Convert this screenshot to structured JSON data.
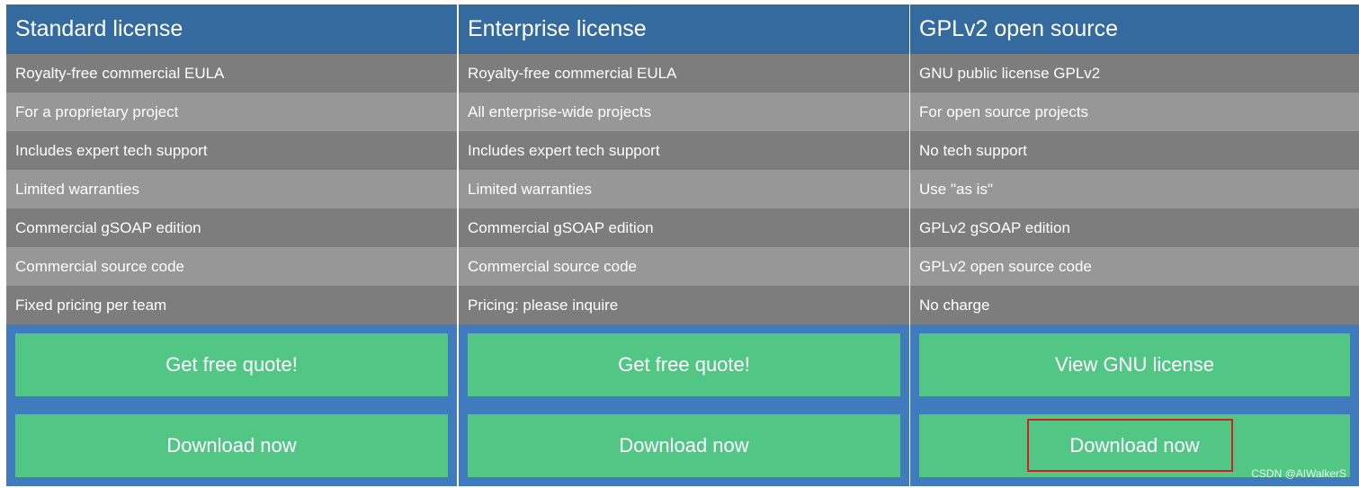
{
  "columns": [
    {
      "title": "Standard license",
      "features": [
        "Royalty-free commercial EULA",
        "For a proprietary project",
        "Includes expert tech support",
        "Limited warranties",
        "Commercial gSOAP edition",
        "Commercial source code",
        "Fixed pricing per team"
      ],
      "primary_button": "Get free quote!",
      "download_button": "Download now"
    },
    {
      "title": "Enterprise license",
      "features": [
        "Royalty-free commercial EULA",
        "All enterprise-wide projects",
        "Includes expert tech support",
        "Limited warranties",
        "Commercial gSOAP edition",
        "Commercial source code",
        "Pricing: please inquire"
      ],
      "primary_button": "Get free quote!",
      "download_button": "Download now"
    },
    {
      "title": "GPLv2 open source",
      "features": [
        "GNU public license GPLv2",
        "For open source projects",
        "No tech support",
        "Use \"as is\"",
        "GPLv2 gSOAP edition",
        "GPLv2 open source code",
        "No charge"
      ],
      "primary_button": "View GNU license",
      "download_button": "Download now"
    }
  ],
  "watermark": "CSDN @AIWalkerS",
  "colors": {
    "header": "#356a9f",
    "frame": "#3f7bbd",
    "row_dark": "#7d7d7d",
    "row_light": "#979797",
    "button": "#52c785",
    "highlight": "#d21f1f"
  }
}
